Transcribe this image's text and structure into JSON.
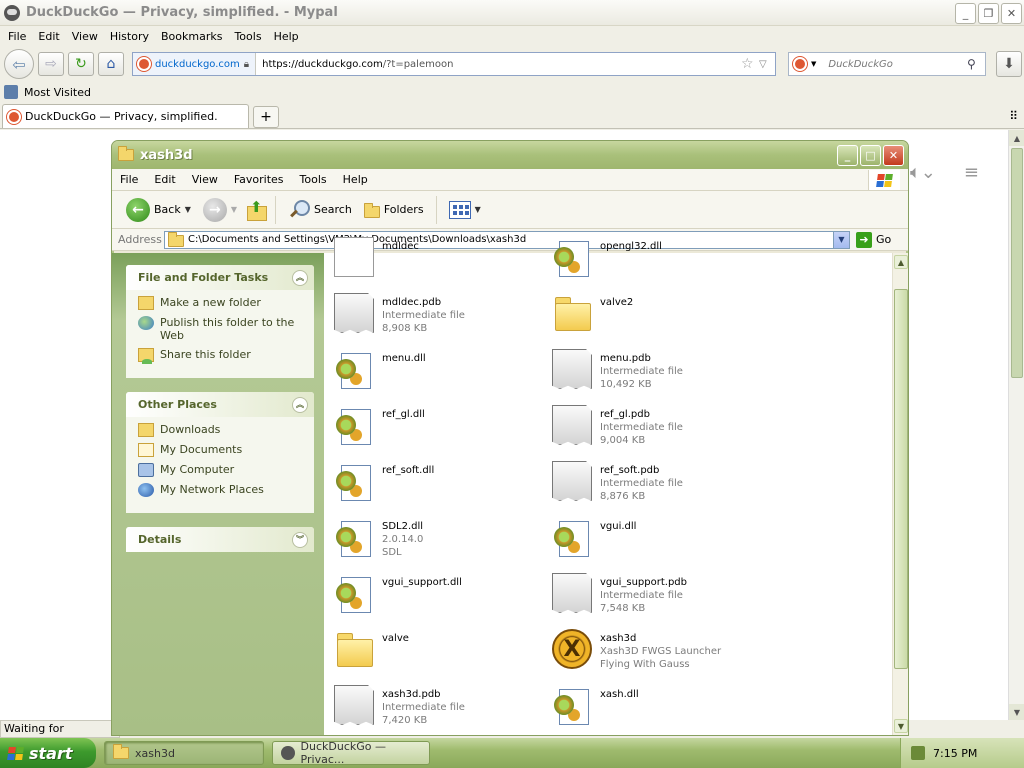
{
  "browser": {
    "title": "DuckDuckGo — Privacy, simplified. - Mypal",
    "menu": [
      "File",
      "Edit",
      "View",
      "History",
      "Bookmarks",
      "Tools",
      "Help"
    ],
    "identity": "duckduckgo.com",
    "url_scheme_host": "https://duckduckgo.com",
    "url_path": "/?t=palemoon",
    "search_placeholder": "DuckDuckGo",
    "bookmark": "Most Visited",
    "tab_title": "DuckDuckGo — Privacy, simplified.",
    "status": "Waiting for improving..."
  },
  "explorer": {
    "title": "xash3d",
    "menu": [
      "File",
      "Edit",
      "View",
      "Favorites",
      "Tools",
      "Help"
    ],
    "toolbar": {
      "back": "Back",
      "search": "Search",
      "folders": "Folders"
    },
    "address_label": "Address",
    "address": "C:\\Documents and Settings\\VM2\\My Documents\\Downloads\\xash3d",
    "go": "Go",
    "panels": {
      "tasks": {
        "title": "File and Folder Tasks",
        "items": [
          "Make a new folder",
          "Publish this folder to the Web",
          "Share this folder"
        ]
      },
      "places": {
        "title": "Other Places",
        "items": [
          "Downloads",
          "My Documents",
          "My Computer",
          "My Network Places"
        ]
      },
      "details": {
        "title": "Details"
      }
    },
    "files": [
      {
        "name": "mdldec",
        "type": "",
        "size": "",
        "icon": "blank-icon"
      },
      {
        "name": "opengl32.dll",
        "type": "",
        "size": "",
        "icon": "dll-icon"
      },
      {
        "name": "mdldec.pdb",
        "type": "Intermediate file",
        "size": "8,908 KB",
        "icon": "pdb-icon"
      },
      {
        "name": "valve2",
        "type": "",
        "size": "",
        "icon": "folder-icon"
      },
      {
        "name": "menu.dll",
        "type": "",
        "size": "",
        "icon": "dll-icon"
      },
      {
        "name": "menu.pdb",
        "type": "Intermediate file",
        "size": "10,492 KB",
        "icon": "pdb-icon"
      },
      {
        "name": "ref_gl.dll",
        "type": "",
        "size": "",
        "icon": "dll-icon"
      },
      {
        "name": "ref_gl.pdb",
        "type": "Intermediate file",
        "size": "9,004 KB",
        "icon": "pdb-icon"
      },
      {
        "name": "ref_soft.dll",
        "type": "",
        "size": "",
        "icon": "dll-icon"
      },
      {
        "name": "ref_soft.pdb",
        "type": "Intermediate file",
        "size": "8,876 KB",
        "icon": "pdb-icon"
      },
      {
        "name": "SDL2.dll",
        "type": "2.0.14.0",
        "size": "SDL",
        "icon": "dll-icon"
      },
      {
        "name": "vgui.dll",
        "type": "",
        "size": "",
        "icon": "dll-icon"
      },
      {
        "name": "vgui_support.dll",
        "type": "",
        "size": "",
        "icon": "dll-icon"
      },
      {
        "name": "vgui_support.pdb",
        "type": "Intermediate file",
        "size": "7,548 KB",
        "icon": "pdb-icon"
      },
      {
        "name": "valve",
        "type": "",
        "size": "",
        "icon": "folder-icon"
      },
      {
        "name": "xash3d",
        "type": "Xash3D FWGS Launcher",
        "size": "Flying With Gauss",
        "icon": "xash-launcher-icon"
      },
      {
        "name": "xash3d.pdb",
        "type": "Intermediate file",
        "size": "7,420 KB",
        "icon": "pdb-icon"
      },
      {
        "name": "xash.dll",
        "type": "",
        "size": "",
        "icon": "dll-icon"
      }
    ]
  },
  "taskbar": {
    "start": "start",
    "items": [
      "xash3d",
      "DuckDuckGo — Privac..."
    ],
    "clock": "7:15 PM"
  },
  "colors": {
    "xp_olive_title": "#a9c07a",
    "xp_sidebar": "#b4c995",
    "ddg_orange": "#de5833",
    "start_green": "#3d9a2d"
  }
}
